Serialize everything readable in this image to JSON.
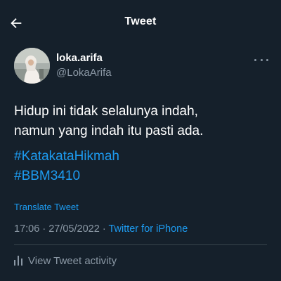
{
  "header": {
    "title": "Tweet",
    "back_icon": "arrow-left-icon"
  },
  "author": {
    "display_name": "loka.arifa",
    "handle": "@LokaArifa",
    "avatar": "profile-photo",
    "more_icon": "more-horizontal-icon"
  },
  "tweet": {
    "lines": [
      "Hidup ini tidak selalunya indah,",
      "namun yang indah itu pasti ada."
    ],
    "hashtags": [
      "#KatakataHikmah",
      "#BBM3410"
    ],
    "translate_label": "Translate Tweet",
    "time": "17:06",
    "date": "27/05/2022",
    "separator": "·",
    "source": "Twitter for iPhone"
  },
  "activity": {
    "label": "View Tweet activity",
    "icon": "bar-chart-icon"
  },
  "colors": {
    "background": "#15202b",
    "text": "#ffffff",
    "secondary": "#8b98a5",
    "accent": "#1d9bf0",
    "divider": "#38444d"
  }
}
